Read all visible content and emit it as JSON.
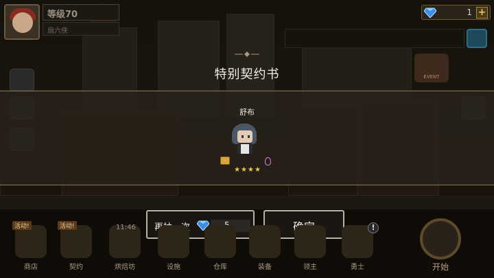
{
  "player": {
    "level_label": "等级70",
    "name": "扇六侠"
  },
  "currency": {
    "gems": "1",
    "plus_label": "+",
    "gem_color": "#4aa8ff"
  },
  "event_label": "EVENT",
  "modal": {
    "title": "特别契约书",
    "hero_name": "舒布",
    "stars": "★★★★",
    "star_count": 4,
    "redraw_label": "再抽一次",
    "redraw_cost": "5",
    "confirm_label": "确定"
  },
  "nav": {
    "items": [
      {
        "label": "商店",
        "badge": "活动!"
      },
      {
        "label": "契约",
        "badge": "活动!"
      },
      {
        "label": "烘焙坊",
        "timer": "11:46"
      },
      {
        "label": "设施"
      },
      {
        "label": "仓库"
      },
      {
        "label": "装备"
      },
      {
        "label": "领主"
      },
      {
        "label": "勇士",
        "alert": "!"
      }
    ],
    "start_label": "开始"
  }
}
